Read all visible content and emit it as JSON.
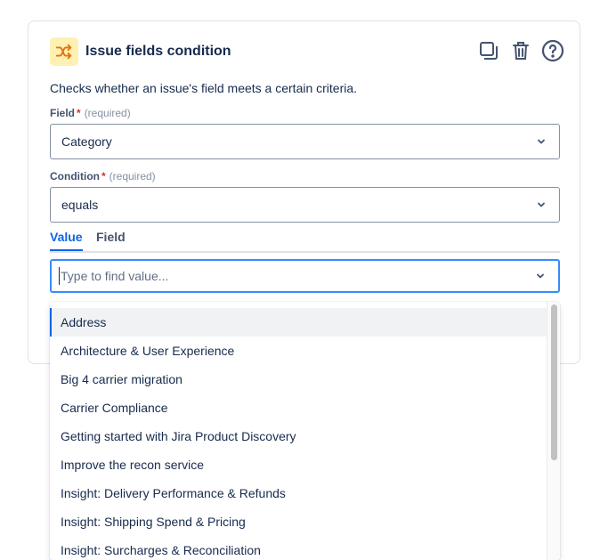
{
  "card": {
    "title": "Issue fields condition",
    "description": "Checks whether an issue's field meets a certain criteria.",
    "icon": "shuffle-icon",
    "actions": [
      "copy-icon",
      "trash-icon",
      "help-icon"
    ]
  },
  "field": {
    "label": "Field",
    "required_star": "*",
    "required_hint": "(required)",
    "value": "Category"
  },
  "condition": {
    "label": "Condition",
    "required_star": "*",
    "required_hint": "(required)",
    "value": "equals"
  },
  "tabs": [
    {
      "label": "Value",
      "active": true
    },
    {
      "label": "Field",
      "active": false
    }
  ],
  "search": {
    "placeholder": "Type to find value...",
    "value": ""
  },
  "options": [
    "Address",
    "Architecture & User Experience",
    "Big 4 carrier migration",
    "Carrier Compliance",
    "Getting started with Jira Product Discovery",
    "Improve the recon service",
    "Insight: Delivery Performance & Refunds",
    "Insight: Shipping Spend & Pricing",
    "Insight: Surcharges & Reconciliation"
  ],
  "colors": {
    "accent": "#0c66e4",
    "icon_bg": "#fff0b3",
    "icon_fg": "#e2740e",
    "required": "#c9372c"
  }
}
